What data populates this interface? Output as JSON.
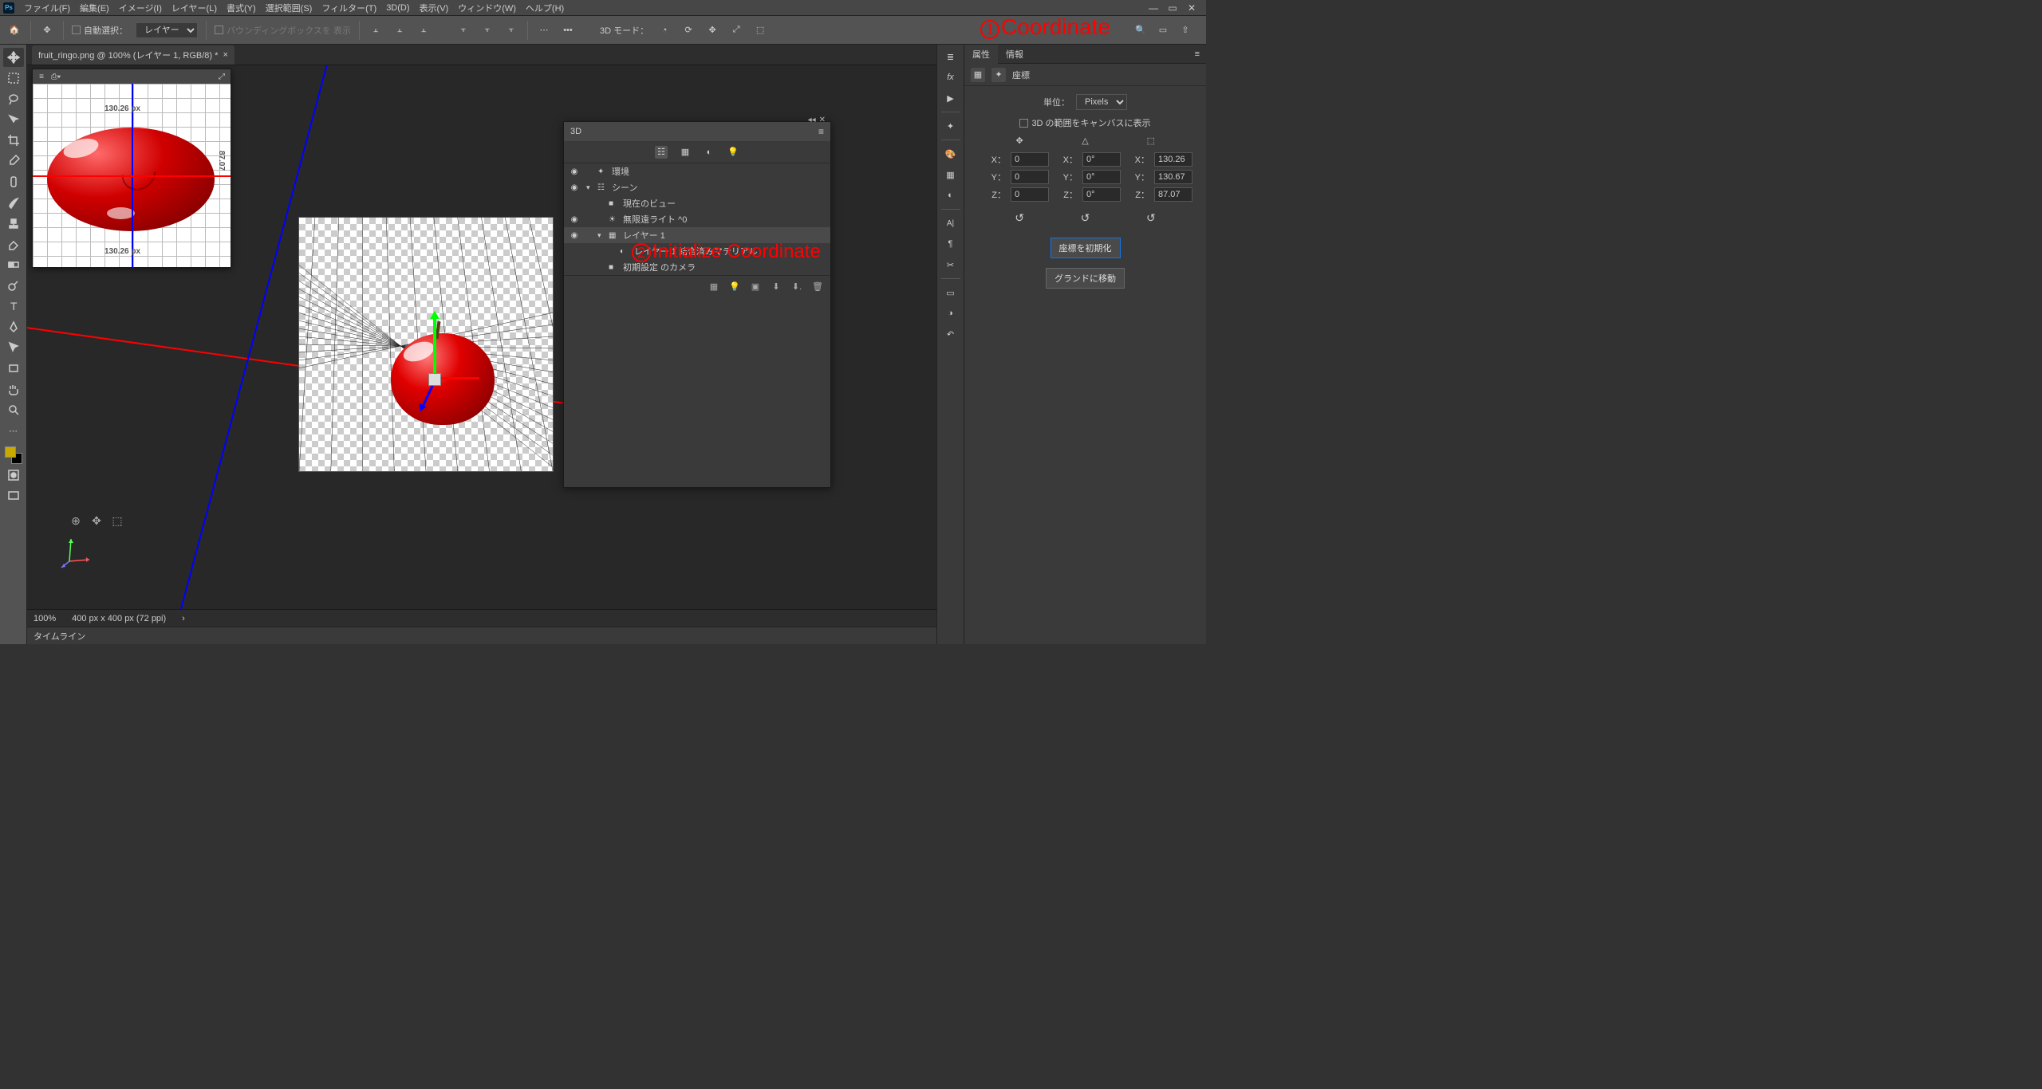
{
  "menubar": [
    "ファイル(F)",
    "編集(E)",
    "イメージ(I)",
    "レイヤー(L)",
    "書式(Y)",
    "選択範囲(S)",
    "フィルター(T)",
    "3D(D)",
    "表示(V)",
    "ウィンドウ(W)",
    "ヘルプ(H)"
  ],
  "optionsbar": {
    "auto_select_label": "自動選択：",
    "auto_select_value": "レイヤー",
    "show_bbox": "バウンディングボックスを 表示",
    "mode_label": "3D モード："
  },
  "document": {
    "tab_title": "fruit_ringo.png @ 100% (レイヤー 1, RGB/8) *",
    "zoom": "100%",
    "dims": "400 px x 400 px (72 ppi)",
    "timeline": "タイムライン"
  },
  "navigator": {
    "label_top": "130.26 px",
    "label_bottom": "130.26 px",
    "label_right": "87.07"
  },
  "panel_3d": {
    "title": "3D",
    "tree": [
      {
        "eye": "◉",
        "indent": 0,
        "icon": "✦",
        "label": "環境"
      },
      {
        "eye": "◉",
        "indent": 0,
        "icon": "☷",
        "label": "シーン",
        "caret": "▾"
      },
      {
        "eye": "",
        "indent": 1,
        "icon": "■",
        "label": "現在のビュー"
      },
      {
        "eye": "◉",
        "indent": 1,
        "icon": "☀",
        "label": "無限遠ライト  ^0"
      },
      {
        "eye": "◉",
        "indent": 1,
        "icon": "▦",
        "label": "レイヤー 1",
        "caret": "▾",
        "selected": true
      },
      {
        "eye": "",
        "indent": 2,
        "icon": "◐",
        "label": "レイヤー 1 結合済みマテリアル"
      },
      {
        "eye": "",
        "indent": 1,
        "icon": "■",
        "label": "初期設定 のカメラ"
      }
    ]
  },
  "properties": {
    "tabs": [
      "属性",
      "情報"
    ],
    "section": "座標",
    "units_label": "単位：",
    "units_value": "Pixels",
    "range_label": "3D の範囲をキャンバスに表示",
    "pos": {
      "x": "0",
      "y": "0",
      "z": "0"
    },
    "rot": {
      "x": "0°",
      "y": "0°",
      "z": "0°"
    },
    "scale": {
      "x": "130.26",
      "y": "130.67",
      "z": "87.07"
    },
    "reset_btn": "座標を初期化",
    "ground_btn": "グランドに移動"
  },
  "annotations": {
    "a1": "Coordinate",
    "a2": "Initialize  Coordinate"
  }
}
